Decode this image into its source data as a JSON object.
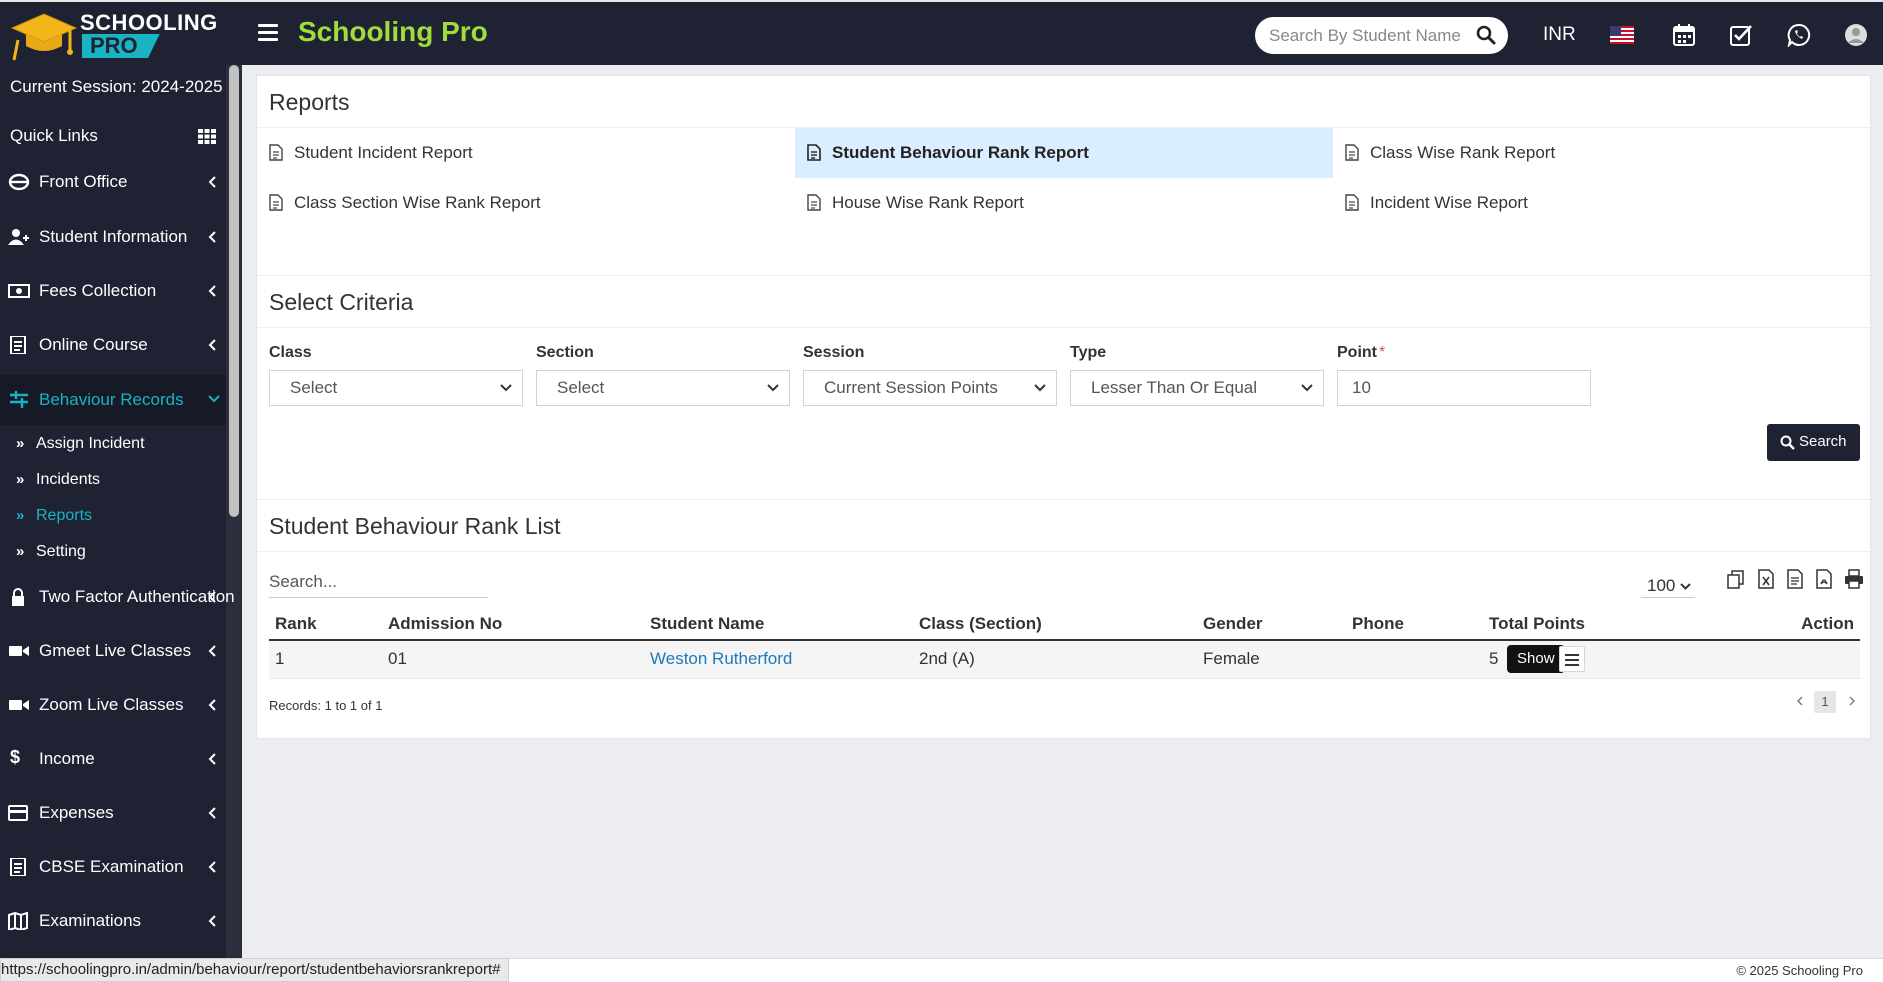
{
  "header": {
    "logo_line1": "SCHOOLING",
    "logo_line2": "PRO",
    "app_title": "Schooling Pro",
    "search_placeholder": "Search By Student Name",
    "currency": "INR",
    "icons": [
      "us-flag-icon",
      "calendar-icon",
      "checkbox-icon",
      "whatsapp-icon",
      "user-avatar-icon"
    ],
    "accent_color": "#9fdd3b",
    "teal_color": "#19b3c4"
  },
  "sidebar": {
    "session": "Current Session: 2024-2025",
    "quick_links": "Quick Links",
    "items": [
      {
        "label": "Front Office",
        "icon": "front-office-icon"
      },
      {
        "label": "Student Information",
        "icon": "user-icon"
      },
      {
        "label": "Fees Collection",
        "icon": "money-icon"
      },
      {
        "label": "Online Course",
        "icon": "course-icon"
      },
      {
        "label": "Behaviour Records",
        "icon": "sliders-icon"
      },
      {
        "label": "Two Factor Authentication",
        "icon": "lock-icon"
      },
      {
        "label": "Gmeet Live Classes",
        "icon": "video-icon"
      },
      {
        "label": "Zoom Live Classes",
        "icon": "video-icon"
      },
      {
        "label": "Income",
        "icon": "dollar-icon"
      },
      {
        "label": "Expenses",
        "icon": "credit-card-icon"
      },
      {
        "label": "CBSE Examination",
        "icon": "document-icon"
      },
      {
        "label": "Examinations",
        "icon": "map-icon"
      }
    ],
    "submenu": [
      {
        "label": "Assign Incident"
      },
      {
        "label": "Incidents"
      },
      {
        "label": "Reports"
      },
      {
        "label": "Setting"
      }
    ]
  },
  "reports": {
    "title": "Reports",
    "links": [
      "Student Incident Report",
      "Student Behaviour Rank Report",
      "Class Wise Rank Report",
      "Class Section Wise Rank Report",
      "House Wise Rank Report",
      "Incident Wise Report"
    ]
  },
  "criteria": {
    "title": "Select Criteria",
    "class_label": "Class",
    "class_value": "Select",
    "section_label": "Section",
    "section_value": "Select",
    "session_label": "Session",
    "session_value": "Current Session Points",
    "type_label": "Type",
    "type_value": "Lesser Than Or Equal",
    "point_label": "Point",
    "point_required": "*",
    "point_value": "10",
    "search_button": "Search"
  },
  "list": {
    "title": "Student Behaviour Rank List",
    "search_placeholder": "Search...",
    "page_size": "100",
    "columns": [
      "Rank",
      "Admission No",
      "Student Name",
      "Class (Section)",
      "Gender",
      "Phone",
      "Total Points",
      "Action"
    ],
    "rows": [
      {
        "rank": "1",
        "admission_no": "01",
        "student_name": "Weston Rutherford",
        "class_section": "2nd (A)",
        "gender": "Female",
        "phone": "",
        "total_points": "5"
      }
    ],
    "tooltip": "Show",
    "records_text": "Records: 1 to 1 of 1",
    "current_page": "1"
  },
  "footer": {
    "status_url": "https://schoolingpro.in/admin/behaviour/report/studentbehaviorsrankreport#",
    "copyright": "© 2025 Schooling Pro"
  }
}
